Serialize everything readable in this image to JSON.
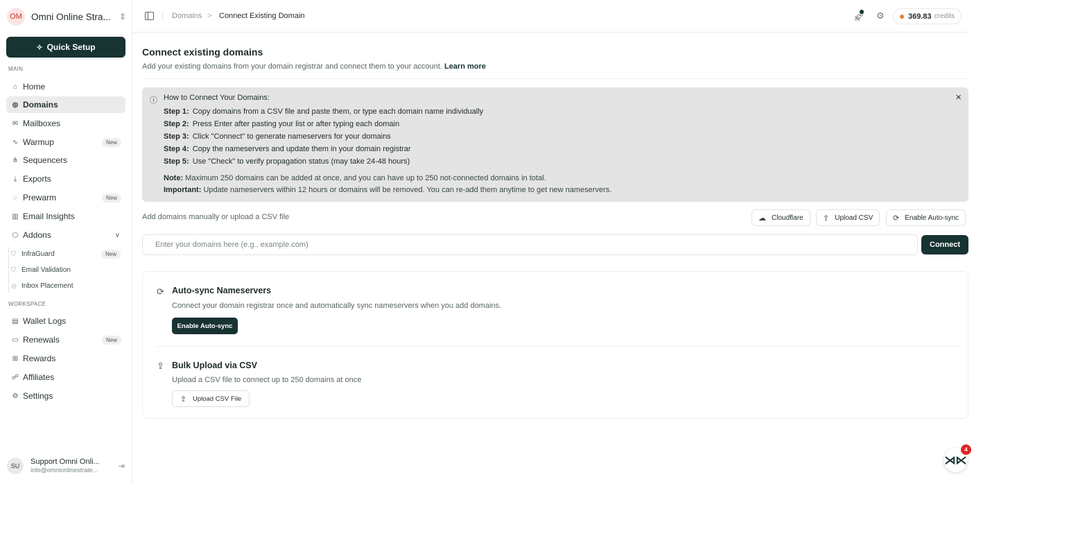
{
  "workspace": {
    "initials": "OM",
    "name": "Omni Online Stra..."
  },
  "quick_setup": "Quick Setup",
  "sections": {
    "main": "MAIN",
    "workspace": "WORKSPACE"
  },
  "nav": {
    "home": "Home",
    "domains": "Domains",
    "mailboxes": "Mailboxes",
    "warmup": "Warmup",
    "sequencers": "Sequencers",
    "exports": "Exports",
    "prewarm": "Prewarm",
    "email_insights": "Email Insights",
    "addons": "Addons",
    "infraguard": "InfraGuard",
    "email_validation": "Email Validation",
    "inbox_placement": "Inbox Placement",
    "wallet_logs": "Wallet Logs",
    "renewals": "Renewals",
    "rewards": "Rewards",
    "affiliates": "Affiliates",
    "settings": "Settings",
    "new_badge": "New"
  },
  "user": {
    "initials": "SU",
    "name": "Support Omni Onli...",
    "email": "info@omnionlinestrate..."
  },
  "breadcrumb": {
    "parent": "Domains",
    "separator": ">",
    "current": "Connect Existing Domain"
  },
  "credits": {
    "amount": "369.83",
    "unit": "credits"
  },
  "page": {
    "title": "Connect existing domains",
    "subtitle": "Add your existing domains from your domain registrar and connect them to your account.",
    "learn_more": "Learn more"
  },
  "howto": {
    "title": "How to Connect Your Domains:",
    "steps": [
      {
        "label": "Step 1:",
        "text": "Copy domains from a CSV file and paste them, or type each domain name individually"
      },
      {
        "label": "Step 2:",
        "text": "Press Enter after pasting your list or after typing each domain"
      },
      {
        "label": "Step 3:",
        "text": "Click \"Connect\" to generate nameservers for your domains"
      },
      {
        "label": "Step 4:",
        "text": "Copy the nameservers and update them in your domain registrar"
      },
      {
        "label": "Step 5:",
        "text": "Use \"Check\" to verify propagation status (may take 24-48 hours)"
      }
    ],
    "note_label": "Note:",
    "note_text": "Maximum 250 domains can be added at once, and you can have up to 250 not-connected domains in total.",
    "important_label": "Important:",
    "important_text": "Update nameservers within 12 hours or domains will be removed. You can re-add them anytime to get new nameservers."
  },
  "add": {
    "label": "Add domains manually or upload a CSV file",
    "cloudflare": "Cloudflare",
    "upload_csv": "Upload CSV",
    "enable_autosync": "Enable Auto-sync",
    "placeholder": "Enter your domains here (e.g., example.com)",
    "connect": "Connect"
  },
  "autosync_card": {
    "title": "Auto-sync Nameservers",
    "desc": "Connect your domain registrar once and automatically sync nameservers when you add domains.",
    "button": "Enable Auto-sync"
  },
  "bulk_card": {
    "title": "Bulk Upload via CSV",
    "desc": "Upload a CSV file to connect up to 250 domains at once",
    "button": "Upload CSV File"
  },
  "fab_badge": "4",
  "colors": {
    "brand_dark": "#173332",
    "credit_dot": "#e0822a",
    "cloudflare": "#e8862f",
    "badge_red": "#e02424"
  }
}
